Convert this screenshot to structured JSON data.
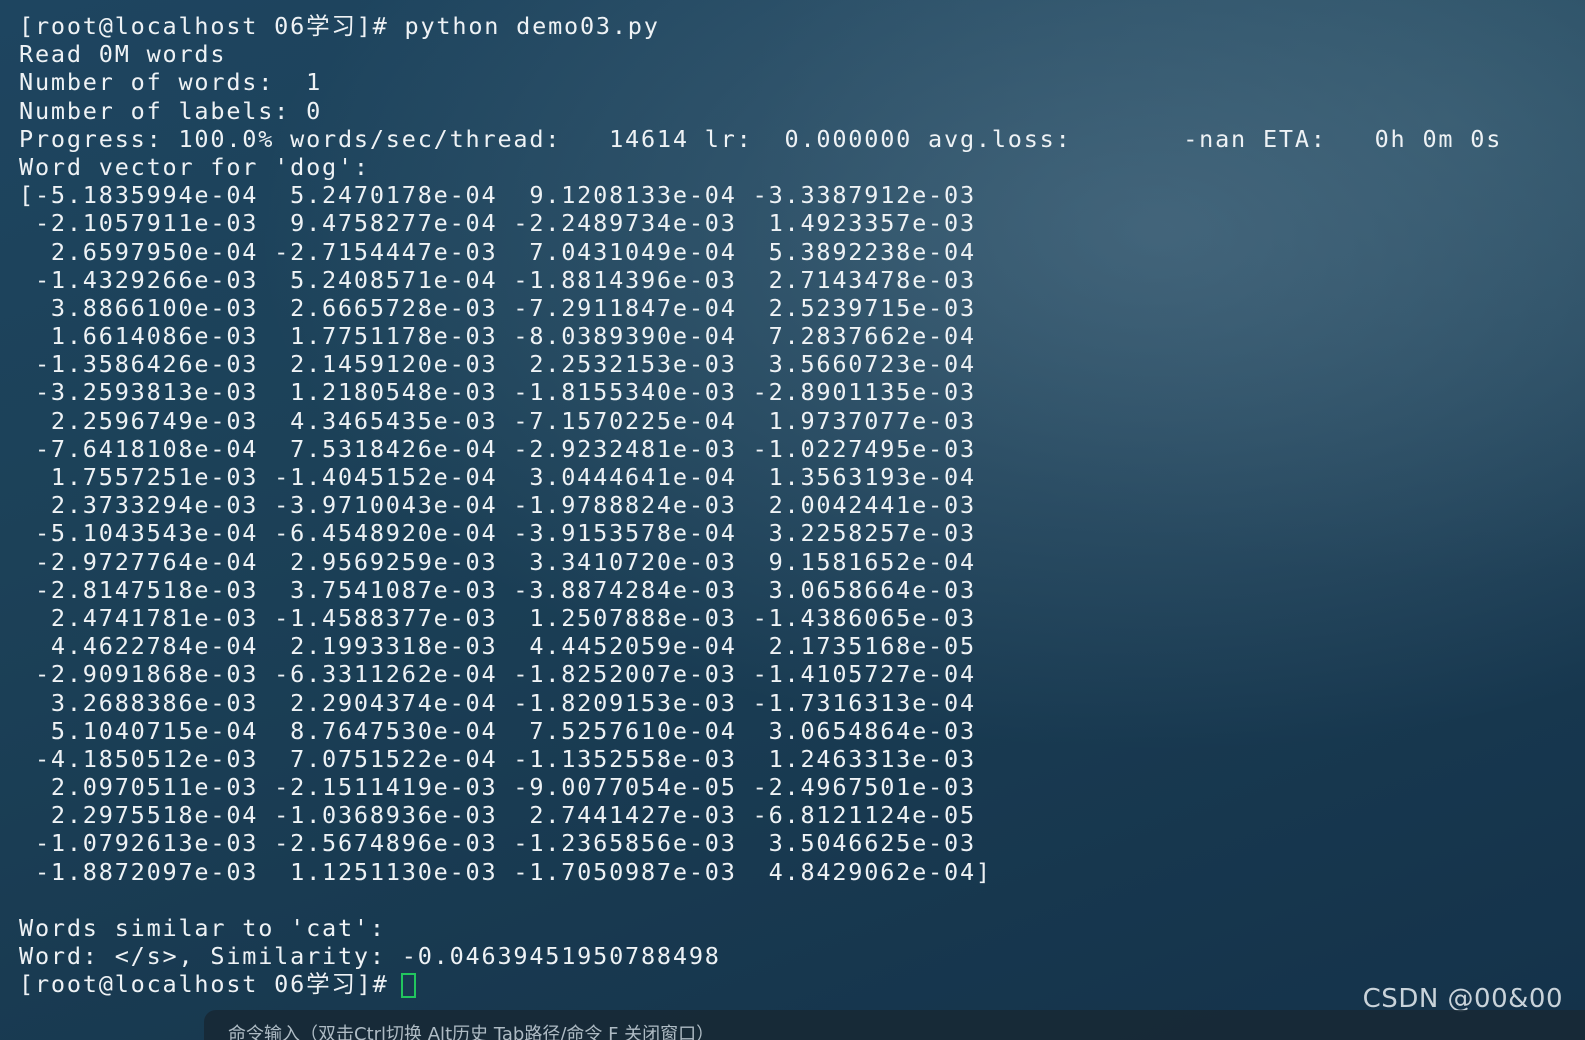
{
  "terminal": {
    "prompt": "[root@localhost 06学习]#",
    "command": "python demo03.py",
    "read_line": "Read 0M words",
    "words_line": "Number of words:  1",
    "labels_line": "Number of labels: 0",
    "progress_line": "Progress: 100.0% words/sec/thread:   14614 lr:  0.000000 avg.loss:       -nan ETA:   0h 0m 0s",
    "vector_header": "Word vector for 'dog':",
    "vector_rows": [
      "[-5.1835994e-04  5.2470178e-04  9.1208133e-04 -3.3387912e-03",
      " -2.1057911e-03  9.4758277e-04 -2.2489734e-03  1.4923357e-03",
      "  2.6597950e-04 -2.7154447e-03  7.0431049e-04  5.3892238e-04",
      " -1.4329266e-03  5.2408571e-04 -1.8814396e-03  2.7143478e-03",
      "  3.8866100e-03  2.6665728e-03 -7.2911847e-04  2.5239715e-03",
      "  1.6614086e-03  1.7751178e-03 -8.0389390e-04  7.2837662e-04",
      " -1.3586426e-03  2.1459120e-03  2.2532153e-03  3.5660723e-04",
      " -3.2593813e-03  1.2180548e-03 -1.8155340e-03 -2.8901135e-03",
      "  2.2596749e-03  4.3465435e-03 -7.1570225e-04  1.9737077e-03",
      " -7.6418108e-04  7.5318426e-04 -2.9232481e-03 -1.0227495e-03",
      "  1.7557251e-03 -1.4045152e-04  3.0444641e-04  1.3563193e-04",
      "  2.3733294e-03 -3.9710043e-04 -1.9788824e-03  2.0042441e-03",
      " -5.1043543e-04 -6.4548920e-04 -3.9153578e-04  3.2258257e-03",
      " -2.9727764e-04  2.9569259e-03  3.3410720e-03  9.1581652e-04",
      " -2.8147518e-03  3.7541087e-03 -3.8874284e-03  3.0658664e-03",
      "  2.4741781e-03 -1.4588377e-03  1.2507888e-03 -1.4386065e-03",
      "  4.4622784e-04  2.1993318e-03  4.4452059e-04  2.1735168e-05",
      " -2.9091868e-03 -6.3311262e-04 -1.8252007e-03 -1.4105727e-04",
      "  3.2688386e-03  2.2904374e-04 -1.8209153e-03 -1.7316313e-04",
      "  5.1040715e-04  8.7647530e-04  7.5257610e-04  3.0654864e-03",
      " -4.1850512e-03  7.0751522e-04 -1.1352558e-03  1.2463313e-03",
      "  2.0970511e-03 -2.1511419e-03 -9.0077054e-05 -2.4967501e-03",
      "  2.2975518e-04 -1.0368936e-03  2.7441427e-03 -6.8121124e-05",
      " -1.0792613e-03 -2.5674896e-03 -1.2365856e-03  3.5046625e-03",
      " -1.8872097e-03  1.1251130e-03 -1.7050987e-03  4.8429062e-04]"
    ],
    "similar_header": "Words similar to 'cat':",
    "similar_result": "Word: </s>, Similarity: -0.04639451950788498",
    "final_prompt": "[root@localhost 06学习]#"
  },
  "watermark": "CSDN @00&00",
  "hint_bar": {
    "text": "命令输入（双击Ctrl切换 Alt历史 Tab路径/命令 F  关闭窗口）"
  },
  "colors": {
    "text": "#eef2f5",
    "cursor": "#22c55e",
    "background": "#1c4158"
  }
}
